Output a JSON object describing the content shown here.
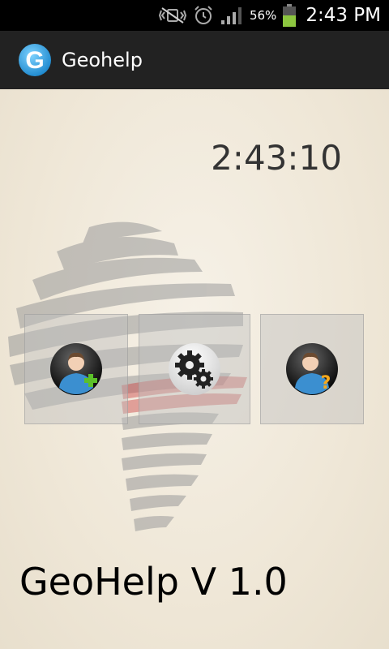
{
  "status_bar": {
    "battery_percent": "56%",
    "time": "2:43 PM",
    "icons": [
      "mute-vibrate-icon",
      "alarm-icon",
      "signal-icon",
      "battery-icon"
    ]
  },
  "action_bar": {
    "title": "Geohelp",
    "logo_icon": "geohelp-logo-icon"
  },
  "main": {
    "clock": "2:43:10",
    "tiles": [
      {
        "name": "add-contact-button",
        "icon": "add-user-icon"
      },
      {
        "name": "settings-button",
        "icon": "gear-icon"
      },
      {
        "name": "help-button",
        "icon": "user-help-icon"
      }
    ],
    "version_label": "GeoHelp V 1.0"
  },
  "colors": {
    "status_bar": "#000000",
    "action_bar": "#222222",
    "background": "#f0e9dc",
    "battery_fill": "#8cc63f",
    "logo_blue": "#2aa6e8",
    "add_green": "#5cc02a",
    "help_orange": "#f7a81b"
  }
}
